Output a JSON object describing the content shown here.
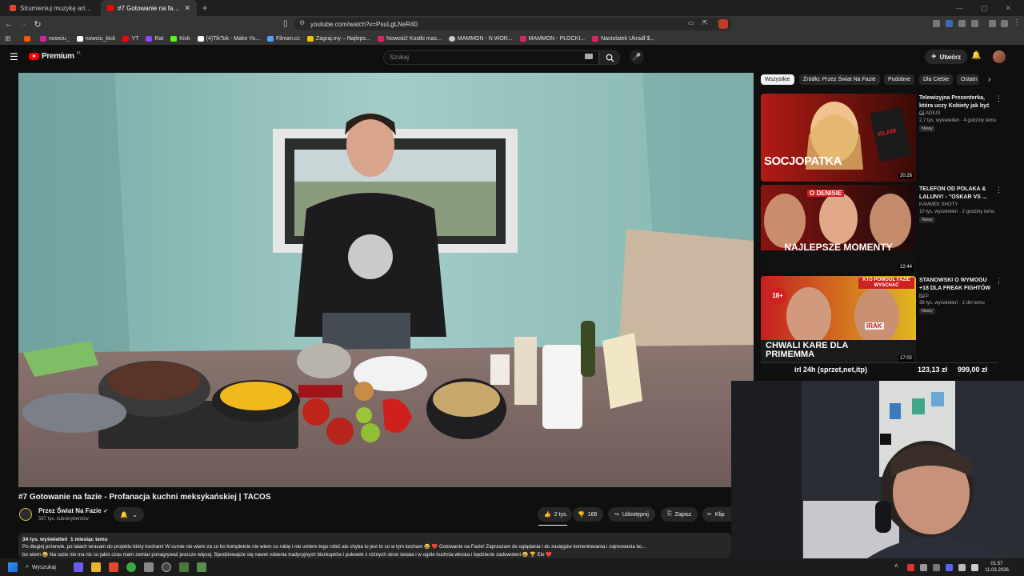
{
  "tabs": [
    {
      "label": "Strumieniuj muzykę artysty nowciu |",
      "active": false,
      "color": "#e8412c"
    },
    {
      "label": "#7 Gotowanie na fazie - Profa",
      "active": true,
      "color": "#ff0000"
    }
  ],
  "address": "youtube.com/watch?v=PsuLgLNeR40",
  "bookmarks": [
    {
      "label": "",
      "color": "#ff5500"
    },
    {
      "label": "nowciu_",
      "color": "#d6249f"
    },
    {
      "label": "nowciu_kick",
      "color": "#ffffff"
    },
    {
      "label": "YT",
      "color": "#ff0000"
    },
    {
      "label": "Rat",
      "color": "#9146ff"
    },
    {
      "label": "Kick",
      "color": "#53fc18"
    },
    {
      "label": "(4)TikTok - Make Yo...",
      "color": "#ffffff"
    },
    {
      "label": "Filman.cc",
      "color": "#4da3ff"
    },
    {
      "label": "Zagraj.my – Najleps...",
      "color": "#f5c400"
    },
    {
      "label": "Nowość! Kostki mas...",
      "color": "#e0245e"
    },
    {
      "label": "MAMMON - N WOR...",
      "color": "#cccccc"
    },
    {
      "label": "MAMMON - PŁOCKI...",
      "color": "#e0245e"
    },
    {
      "label": "Nastolatek Ukradł $...",
      "color": "#e0245e"
    }
  ],
  "yt": {
    "logo": "Premium",
    "logo_sup": "PL",
    "search_placeholder": "Szukaj",
    "create_label": "Utwórz"
  },
  "video": {
    "title": "#7 Gotowanie na fazie - Profanacja kuchni meksykańskiej | TACOS",
    "channel": "Przez Świat Na Fazie",
    "subs": "587 tys. subskrybentów",
    "likes": "2 tys.",
    "dislikes": "166",
    "share": "Udostępnij",
    "save": "Zapisz",
    "clip": "Klip",
    "views": "34 tys. wyświetleń",
    "age": "1 miesiąc temu",
    "desc_line1": "Po długiej przerwie, po latach wracam do projektu który kocham! W sumie nie wiem za co bo kompletnie nie wiem co robię i nie umiem tego robić ale chyba to jest to co w tym kocham 😂 ❤️ Gotowanie na Fazie! Zapraszam do oglądania i do zasięgów komentowania i zajmowania bo...",
    "desc_line2": "bo wiem 😂 Na razie nie ma nic co jakiś czas mam zamiar ponagrywać jeszcze więcej. Spodziewajcie się nawet robienia tradycyjnych biszkoptów i polewek z różnych stron świata i w ogóle kuchnia włoska i będziecie zadowoleni 😂 🏆 Elo ❤️"
  },
  "chips": [
    "Wszystkie",
    "Źródło: Przez Świat Na Fazie",
    "Podobne",
    "Dla Ciebie",
    "Ostatn"
  ],
  "recs": [
    {
      "title": "Telewizyjna Prezenterka, która uczy Kobiety jak być ...",
      "channel": "GLADIUS",
      "meta": "2,7 tys. wyświetleń · 4 godziny temu",
      "badge": "Nowy",
      "duration": "20:26",
      "thumb_text": "SOCJOPATKA",
      "thumb_tag": "KŁAM"
    },
    {
      "title": "TELEFON OD POLAKA & LALUNY! - \"OSKAR VS ...",
      "channel": "KAMMEK SHOTY",
      "meta": "10 tys. wyświetleń · 2 godziny temu",
      "badge": "Nowy",
      "duration": "22:44",
      "thumb_text": "NAJLEPSZE MOMENTY",
      "thumb_tag": "O DENISIE"
    },
    {
      "title": "STANOWSKI O WYMOGU +18 DLA FREAK FIGHTÓW ...",
      "channel": "Kozi",
      "meta": "38 tys. wyświetleń · 2 dni temu",
      "badge": "Nowy",
      "duration": "17:02",
      "thumb_text": "CHWALI KARE DLA PRIMEMMA",
      "thumb_tag": "KTO POMOGŁ FAZIE WYSCHAĆ"
    }
  ],
  "overlay": {
    "text1": "irl 24h (sprzet,net,itp)",
    "text2": "123,13 zł",
    "text3": "999,00 zł"
  },
  "thumb_extra": {
    "age_badge": "18+",
    "sign": "IRAK"
  },
  "taskbar": {
    "search": "Wyszukaj",
    "time": "01:57",
    "date": "11.03.2026"
  }
}
